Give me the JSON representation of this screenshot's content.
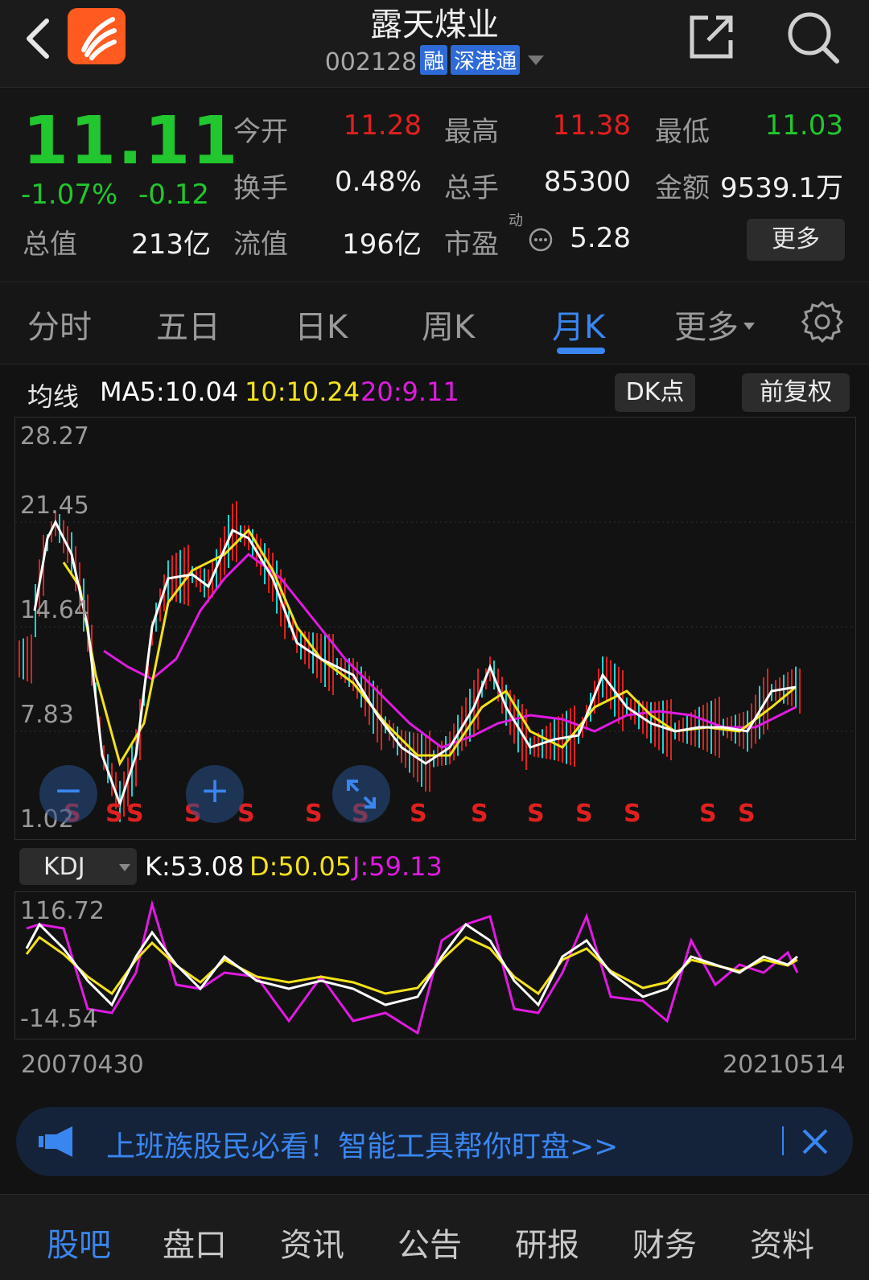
{
  "header": {
    "title": "露天煤业",
    "code": "002128",
    "tag_margin": "融",
    "tag_connect": "深港通",
    "icons": [
      "back-icon",
      "app-logo-icon",
      "share-icon",
      "search-icon"
    ]
  },
  "quote": {
    "price": "11.11",
    "change_pct": "-1.07%",
    "change_abs": "-0.12",
    "fields": [
      {
        "label": "今开",
        "value": "11.28",
        "color": "#e02020"
      },
      {
        "label": "最高",
        "value": "11.38",
        "color": "#e02020"
      },
      {
        "label": "最低",
        "value": "11.03",
        "color": "#22c62e"
      },
      {
        "label": "换手",
        "value": "0.48%"
      },
      {
        "label": "总手",
        "value": "85300"
      },
      {
        "label": "金额",
        "value": "9539.1万"
      },
      {
        "label": "总值",
        "value": "213亿"
      },
      {
        "label": "流值",
        "value": "196亿"
      },
      {
        "label": "市盈",
        "value": "5.28"
      }
    ],
    "pe_superscript": "动",
    "more_label": "更多"
  },
  "tabs": {
    "items": [
      "分时",
      "五日",
      "日K",
      "周K",
      "月K",
      "更多"
    ],
    "active": "月K"
  },
  "ma": {
    "label": "均线",
    "ma5": "MA5:10.04",
    "ma10": "10:10.24",
    "ma20": "20:9.11",
    "dk_label": "DK点",
    "adjust_label": "前复权",
    "colors": {
      "ma5": "#ffffff",
      "ma10": "#f3e21b",
      "ma20": "#e01be0"
    }
  },
  "main_chart": {
    "y_labels": [
      "28.27",
      "21.45",
      "14.64",
      "7.83",
      "1.02"
    ],
    "signal_label": "S",
    "zoom_out": "−",
    "zoom_in": "+"
  },
  "kdj": {
    "selector": "KDJ",
    "k": "K:53.08",
    "d": "D:50.05",
    "j": "J:59.13",
    "y_labels": [
      "116.72",
      "-14.54"
    ]
  },
  "dates": {
    "start": "20070430",
    "end": "20210514"
  },
  "banner": {
    "text": "上班族股民必看！智能工具帮你盯盘>>"
  },
  "bottom_tabs": {
    "items": [
      "股吧",
      "盘口",
      "资讯",
      "公告",
      "研报",
      "财务",
      "资料"
    ],
    "active": "股吧"
  },
  "colors": {
    "up": "#e02020",
    "down": "#22c62e",
    "accent": "#3a86f0",
    "candle_down": "#1ad4d4"
  }
}
